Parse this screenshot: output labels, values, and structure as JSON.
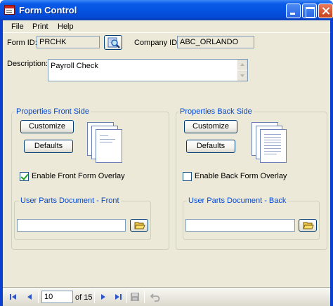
{
  "window": {
    "title": "Form Control"
  },
  "menu": {
    "items": [
      "File",
      "Print",
      "Help"
    ]
  },
  "form": {
    "form_id_label": "Form ID:",
    "form_id_value": "PRCHK",
    "company_id_label": "Company ID:",
    "company_id_value": "ABC_ORLANDO",
    "description_label": "Description:",
    "description_value": "Payroll Check"
  },
  "front": {
    "group_title": "Properties Front Side",
    "customize_label": "Customize",
    "defaults_label": "Defaults",
    "overlay_label": "Enable Front Form Overlay",
    "overlay_checked": true,
    "user_parts_title": "User Parts Document - Front",
    "user_parts_value": ""
  },
  "back": {
    "group_title": "Properties Back Side",
    "customize_label": "Customize",
    "defaults_label": "Defaults",
    "overlay_label": "Enable Back Form Overlay",
    "overlay_checked": false,
    "user_parts_title": "User Parts Document - Back",
    "user_parts_value": ""
  },
  "navigator": {
    "position": "10",
    "count_label": "of 15"
  },
  "colors": {
    "titlebar": "#0553e1",
    "window_bg": "#ece9d8",
    "group_title": "#0046d5",
    "nav_icon": "#2f55c8"
  }
}
